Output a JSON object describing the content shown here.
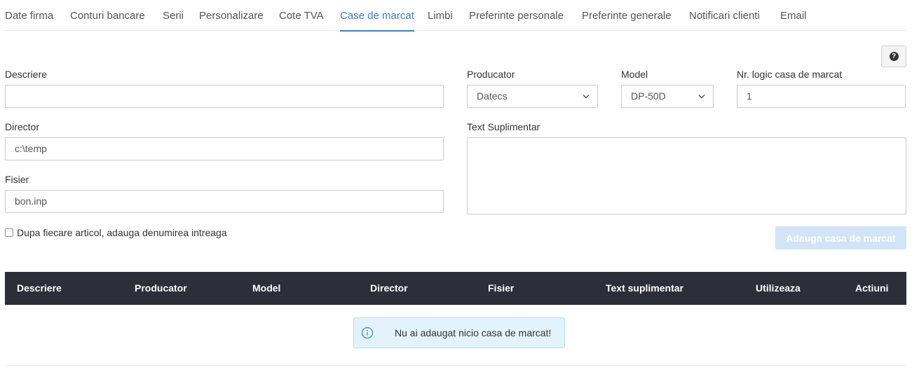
{
  "tabs": [
    {
      "label": "Date firma",
      "active": false
    },
    {
      "label": "Conturi bancare",
      "active": false
    },
    {
      "label": "Serii",
      "active": false
    },
    {
      "label": "Personalizare",
      "active": false
    },
    {
      "label": "Cote TVA",
      "active": false
    },
    {
      "label": "Case de marcat",
      "active": true
    },
    {
      "label": "Limbi",
      "active": false
    },
    {
      "label": "Preferinte personale",
      "active": false
    },
    {
      "label": "Preferinte generale",
      "active": false
    },
    {
      "label": "Notificari clienti",
      "active": false
    },
    {
      "label": "Email",
      "active": false
    }
  ],
  "help": {
    "icon": "question-circle-icon"
  },
  "form": {
    "descriere": {
      "label": "Descriere",
      "value": ""
    },
    "producator": {
      "label": "Producator",
      "value": "Datecs"
    },
    "model": {
      "label": "Model",
      "value": "DP-50D"
    },
    "nr_logic": {
      "label": "Nr. logic casa de marcat",
      "value": "1"
    },
    "director": {
      "label": "Director",
      "value": "c:\\temp"
    },
    "text_suplimentar": {
      "label": "Text Suplimentar",
      "value": ""
    },
    "fisier": {
      "label": "Fisier",
      "value": "bon.inp"
    },
    "checkbox_label": "Dupa fiecare articol, adauga denumirea intreaga",
    "checkbox_checked": false,
    "add_button": "Adauga casa de marcat"
  },
  "table": {
    "headers": [
      "Descriere",
      "Producator",
      "Model",
      "Director",
      "Fisier",
      "Text suplimentar",
      "Utilizeaza",
      "Actiuni"
    ]
  },
  "empty_message": "Nu ai adaugat nicio casa de marcat!",
  "colors": {
    "accent": "#3d80c9",
    "table_header": "#2c2f3a",
    "alert_bg": "#e3f3fb",
    "button_disabled": "#d2e4f8"
  }
}
